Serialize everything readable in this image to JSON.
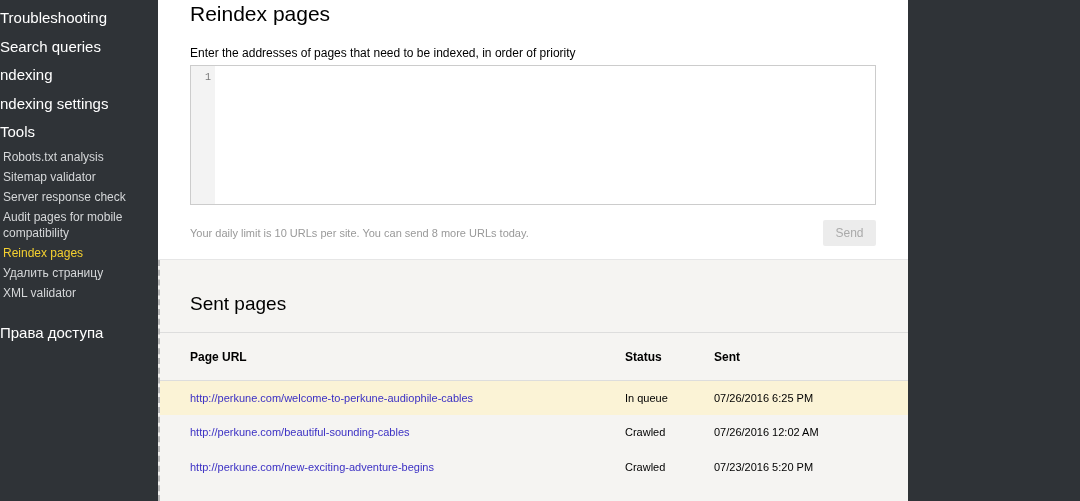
{
  "sidebar": {
    "items": [
      {
        "label": "Troubleshooting",
        "selected": false
      },
      {
        "label": "Search queries",
        "selected": false
      },
      {
        "label": "ndexing",
        "selected": false
      },
      {
        "label": "ndexing settings",
        "selected": false
      },
      {
        "label": "Tools",
        "selected": false,
        "children": [
          {
            "label": "Robots.txt analysis",
            "selected": false
          },
          {
            "label": "Sitemap validator",
            "selected": false
          },
          {
            "label": "Server response check",
            "selected": false
          },
          {
            "label": "Audit pages for mobile compatibility",
            "selected": false
          },
          {
            "label": "Reindex pages",
            "selected": true
          },
          {
            "label": "Удалить страницу",
            "selected": false
          },
          {
            "label": "XML validator",
            "selected": false
          }
        ]
      },
      {
        "label": "Права доступа",
        "selected": false
      }
    ]
  },
  "reindex": {
    "title": "Reindex pages",
    "field_label": "Enter the addresses of pages that need to be indexed, in order of priority",
    "line_number": "1",
    "limit_note": "Your daily limit is 10 URLs per site. You can send 8 more URLs today.",
    "send_button": {
      "label": "Send",
      "disabled": true
    }
  },
  "sent_pages": {
    "title": "Sent pages",
    "columns": [
      "Page URL",
      "Status",
      "Sent"
    ],
    "rows": [
      {
        "url": "http://perkune.com/welcome-to-perkune-audiophile-cables",
        "status": "In queue",
        "sent": "07/26/2016 6:25 PM",
        "selected": true
      },
      {
        "url": "http://perkune.com/beautiful-sounding-cables",
        "status": "Crawled",
        "sent": "07/26/2016 12:02 AM",
        "selected": false
      },
      {
        "url": "http://perkune.com/new-exciting-adventure-begins",
        "status": "Crawled",
        "sent": "07/23/2016 5:20 PM",
        "selected": false
      }
    ]
  }
}
